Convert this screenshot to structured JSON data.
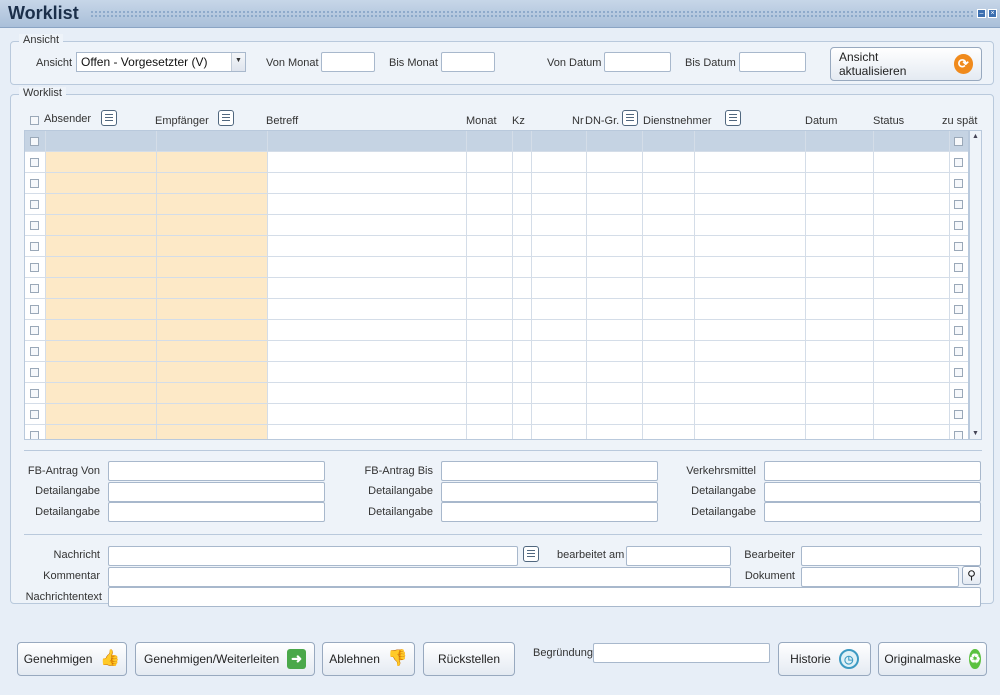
{
  "window": {
    "title": "Worklist"
  },
  "ansicht": {
    "group_label": "Ansicht",
    "ansicht_label": "Ansicht",
    "ansicht_value": "Offen - Vorgesetzter (V)",
    "von_monat_label": "Von Monat",
    "bis_monat_label": "Bis Monat",
    "von_datum_label": "Von Datum",
    "bis_datum_label": "Bis Datum",
    "refresh_label": "Ansicht aktualisieren"
  },
  "worklist": {
    "group_label": "Worklist",
    "columns": {
      "absender": "Absender",
      "empfaenger": "Empfänger",
      "betreff": "Betreff",
      "monat": "Monat",
      "kz": "Kz",
      "nr": "Nr",
      "dn_gr": "DN-Gr.",
      "dienstnehmer": "Dienstnehmer",
      "datum": "Datum",
      "status": "Status",
      "zu_spaet": "zu spät"
    }
  },
  "details": {
    "fb_antrag_von": "FB-Antrag Von",
    "fb_antrag_bis": "FB-Antrag Bis",
    "verkehrsmittel": "Verkehrsmittel",
    "detailangabe": "Detailangabe"
  },
  "message": {
    "nachricht": "Nachricht",
    "bearbeitet_am": "bearbeitet am",
    "bearbeiter": "Bearbeiter",
    "kommentar": "Kommentar",
    "dokument": "Dokument",
    "nachrichtentext": "Nachrichtentext"
  },
  "actions": {
    "genehmigen": "Genehmigen",
    "genehmigen_weiterleiten": "Genehmigen/Weiterleiten",
    "ablehnen": "Ablehnen",
    "rueckstellen": "Rückstellen",
    "begruendung": "Begründung",
    "historie": "Historie",
    "originalmaske": "Originalmaske"
  },
  "colors": {
    "highlight": "#fde9c7",
    "header_row": "#c5d3e3",
    "accent_orange": "#f08a1c"
  }
}
